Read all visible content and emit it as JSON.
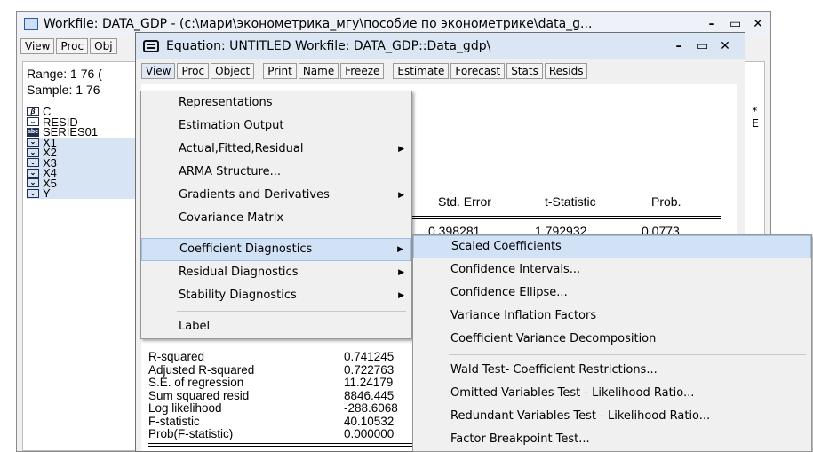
{
  "workfile": {
    "title": "Workfile: DATA_GDP - (c:\\мари\\эконометрика_мгу\\пособие по эконометрике\\data_g...",
    "toolbar": [
      "View",
      "Proc",
      "Obj"
    ],
    "range": "Range: 1 76 (",
    "sample": "Sample: 1 76",
    "right_marks": [
      "*",
      "E"
    ],
    "objects": [
      {
        "icon": "beta",
        "name": "C"
      },
      {
        "icon": "series",
        "name": "RESID"
      },
      {
        "icon": "abc",
        "name": "SERIES01"
      },
      {
        "icon": "series",
        "name": "X1"
      },
      {
        "icon": "series",
        "name": "X2"
      },
      {
        "icon": "series",
        "name": "X3"
      },
      {
        "icon": "series",
        "name": "X4"
      },
      {
        "icon": "series",
        "name": "X5"
      },
      {
        "icon": "series",
        "name": "Y"
      }
    ]
  },
  "equation": {
    "title": "Equation: UNTITLED   Workfile: DATA_GDP::Data_gdp\\",
    "toolbar": [
      "View",
      "Proc",
      "Object",
      "Print",
      "Name",
      "Freeze",
      "Estimate",
      "Forecast",
      "Stats",
      "Resids"
    ],
    "table": {
      "partial_t": "t",
      "headers": [
        "Std. Error",
        "t-Statistic",
        "Prob."
      ],
      "row": [
        "0.398281",
        "1.792932",
        "0.0773"
      ]
    },
    "stats": [
      {
        "label": "R-squared",
        "value": "0.741245"
      },
      {
        "label": "Adjusted R-squared",
        "value": "0.722763"
      },
      {
        "label": "S.E. of regression",
        "value": "11.24179"
      },
      {
        "label": "Sum squared resid",
        "value": "8846.445"
      },
      {
        "label": "Log likelihood",
        "value": "-288.6068"
      },
      {
        "label": "F-statistic",
        "value": "40.10532"
      },
      {
        "label": "Prob(F-statistic)",
        "value": "0.000000"
      }
    ]
  },
  "view_menu": {
    "items": [
      {
        "label": "Representations",
        "sub": false
      },
      {
        "label": "Estimation Output",
        "sub": false
      },
      {
        "label": "Actual,Fitted,Residual",
        "sub": true
      },
      {
        "label": "ARMA Structure...",
        "sub": false
      },
      {
        "label": "Gradients and Derivatives",
        "sub": true
      },
      {
        "label": "Covariance Matrix",
        "sub": false
      },
      {
        "label": "Coefficient Diagnostics",
        "sub": true,
        "highlight": true,
        "sep_before": true
      },
      {
        "label": "Residual Diagnostics",
        "sub": true
      },
      {
        "label": "Stability Diagnostics",
        "sub": true
      },
      {
        "label": "Label",
        "sub": false,
        "sep_before": true
      }
    ]
  },
  "coef_menu": {
    "items": [
      {
        "label": "Scaled Coefficients",
        "highlight": true
      },
      {
        "label": "Confidence Intervals..."
      },
      {
        "label": "Confidence Ellipse..."
      },
      {
        "label": "Variance Inflation Factors"
      },
      {
        "label": "Coefficient Variance Decomposition"
      },
      {
        "label": "Wald Test- Coefficient Restrictions...",
        "sep_before": true
      },
      {
        "label": "Omitted Variables Test - Likelihood Ratio..."
      },
      {
        "label": "Redundant Variables Test - Likelihood Ratio..."
      },
      {
        "label": "Factor Breakpoint Test..."
      }
    ]
  },
  "window_controls": {
    "minimize": "–",
    "maximize": "▭",
    "close": "✕"
  }
}
